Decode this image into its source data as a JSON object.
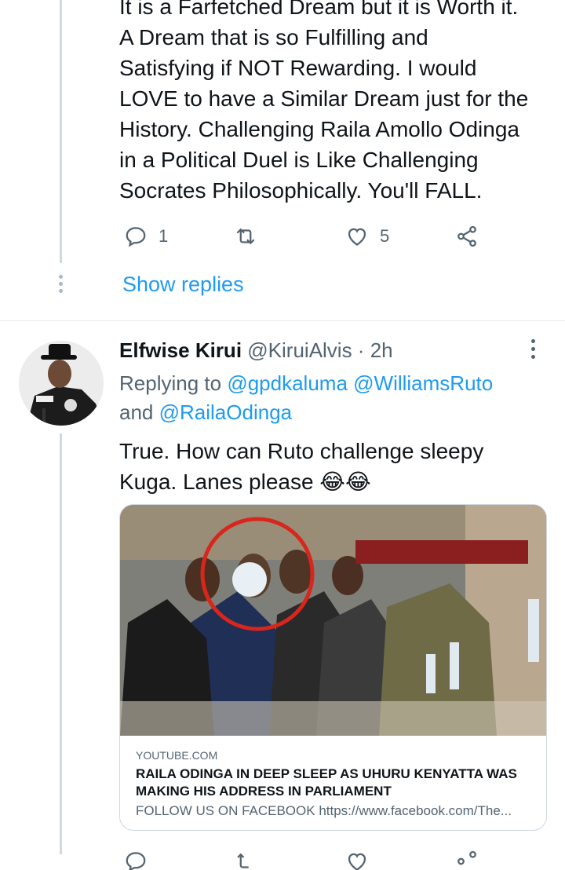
{
  "tweet1": {
    "lines": [
      "It is a Farfetched Dream but it is Worth it.",
      "A Dream that is so Fulfilling and",
      "Satisfying if NOT Rewarding. I would",
      "LOVE to have a Similar Dream just for the",
      "History. Challenging Raila Amollo Odinga",
      "in a Political Duel is Like Challenging",
      "Socrates Philosophically. You'll FALL."
    ],
    "reply_count": "1",
    "like_count": "5"
  },
  "show_replies": "Show replies",
  "tweet2": {
    "name": "Elfwise Kirui",
    "handle_time": "@KiruiAlvis · 2h",
    "replying_prefix": "Replying to",
    "mention1": "@gpdkaluma",
    "mention2": "@WilliamsRuto",
    "and_word": "and",
    "mention3": "@RailaOdinga",
    "body_line1": "True.  How can Ruto challenge  sleepy",
    "body_line2": "Kuga.  Lanes please 😂😂"
  },
  "card": {
    "domain": "YOUTUBE.COM",
    "title_line1": "RAILA ODINGA IN DEEP SLEEP AS UHURU KENYATTA WAS",
    "title_line2": "MAKING HIS ADDRESS IN PARLIAMENT",
    "description": "FOLLOW US ON FACEBOOK https://www.facebook.com/The..."
  },
  "icons": {
    "reply": "reply-icon",
    "retweet": "retweet-icon",
    "like": "heart-icon",
    "share": "share-icon",
    "more": "more-options-icon"
  },
  "colors": {
    "link": "#1d9bf0",
    "muted": "#536471",
    "thread": "#cfd9de"
  }
}
